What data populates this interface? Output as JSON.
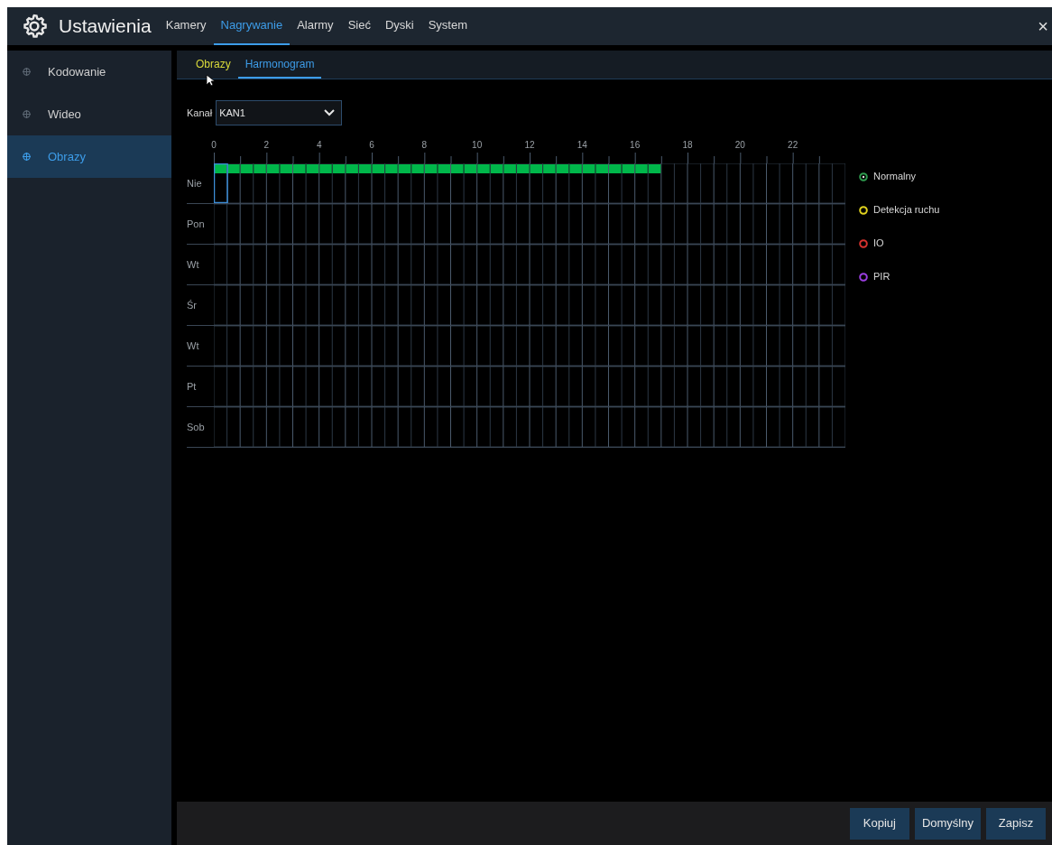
{
  "header": {
    "title": "Ustawienia",
    "tabs": [
      {
        "label": "Kamery",
        "selected": false
      },
      {
        "label": "Nagrywanie",
        "selected": true
      },
      {
        "label": "Alarmy",
        "selected": false
      },
      {
        "label": "Sieć",
        "selected": false
      },
      {
        "label": "Dyski",
        "selected": false
      },
      {
        "label": "System",
        "selected": false
      }
    ],
    "close": "×"
  },
  "sidebar": {
    "items": [
      {
        "label": "Kodowanie",
        "selected": false
      },
      {
        "label": "Wideo",
        "selected": false
      },
      {
        "label": "Obrazy",
        "selected": true
      }
    ]
  },
  "subtabs": [
    {
      "label": "Obrazy",
      "selected": false,
      "hovered": true
    },
    {
      "label": "Harmonogram",
      "selected": true,
      "hovered": false
    }
  ],
  "channel": {
    "label": "Kanał",
    "value": "KAN1"
  },
  "schedule": {
    "hours": [
      "0",
      "2",
      "4",
      "6",
      "8",
      "10",
      "12",
      "14",
      "16",
      "18",
      "20",
      "22"
    ],
    "days": [
      {
        "label": "Nie",
        "level": 0.7083,
        "focused": true
      },
      {
        "label": "Pon",
        "focused": false
      },
      {
        "label": "Wt",
        "focused": false
      },
      {
        "label": "Śr",
        "focused": false
      },
      {
        "label": "Wt",
        "focused": false
      },
      {
        "label": "Pt",
        "focused": false
      },
      {
        "label": "Sob",
        "focused": false
      }
    ]
  },
  "legend": [
    {
      "label": "Normalny",
      "color": "#2e9a4e",
      "selected": true
    },
    {
      "label": "Detekcja ruchu",
      "color": "#e0d21e",
      "selected": false
    },
    {
      "label": "IO",
      "color": "#d8322e",
      "selected": false
    },
    {
      "label": "PIR",
      "color": "#9a3ee0",
      "selected": false
    }
  ],
  "buttons": [
    "Kopiuj",
    "Domyślny",
    "Zapisz"
  ]
}
